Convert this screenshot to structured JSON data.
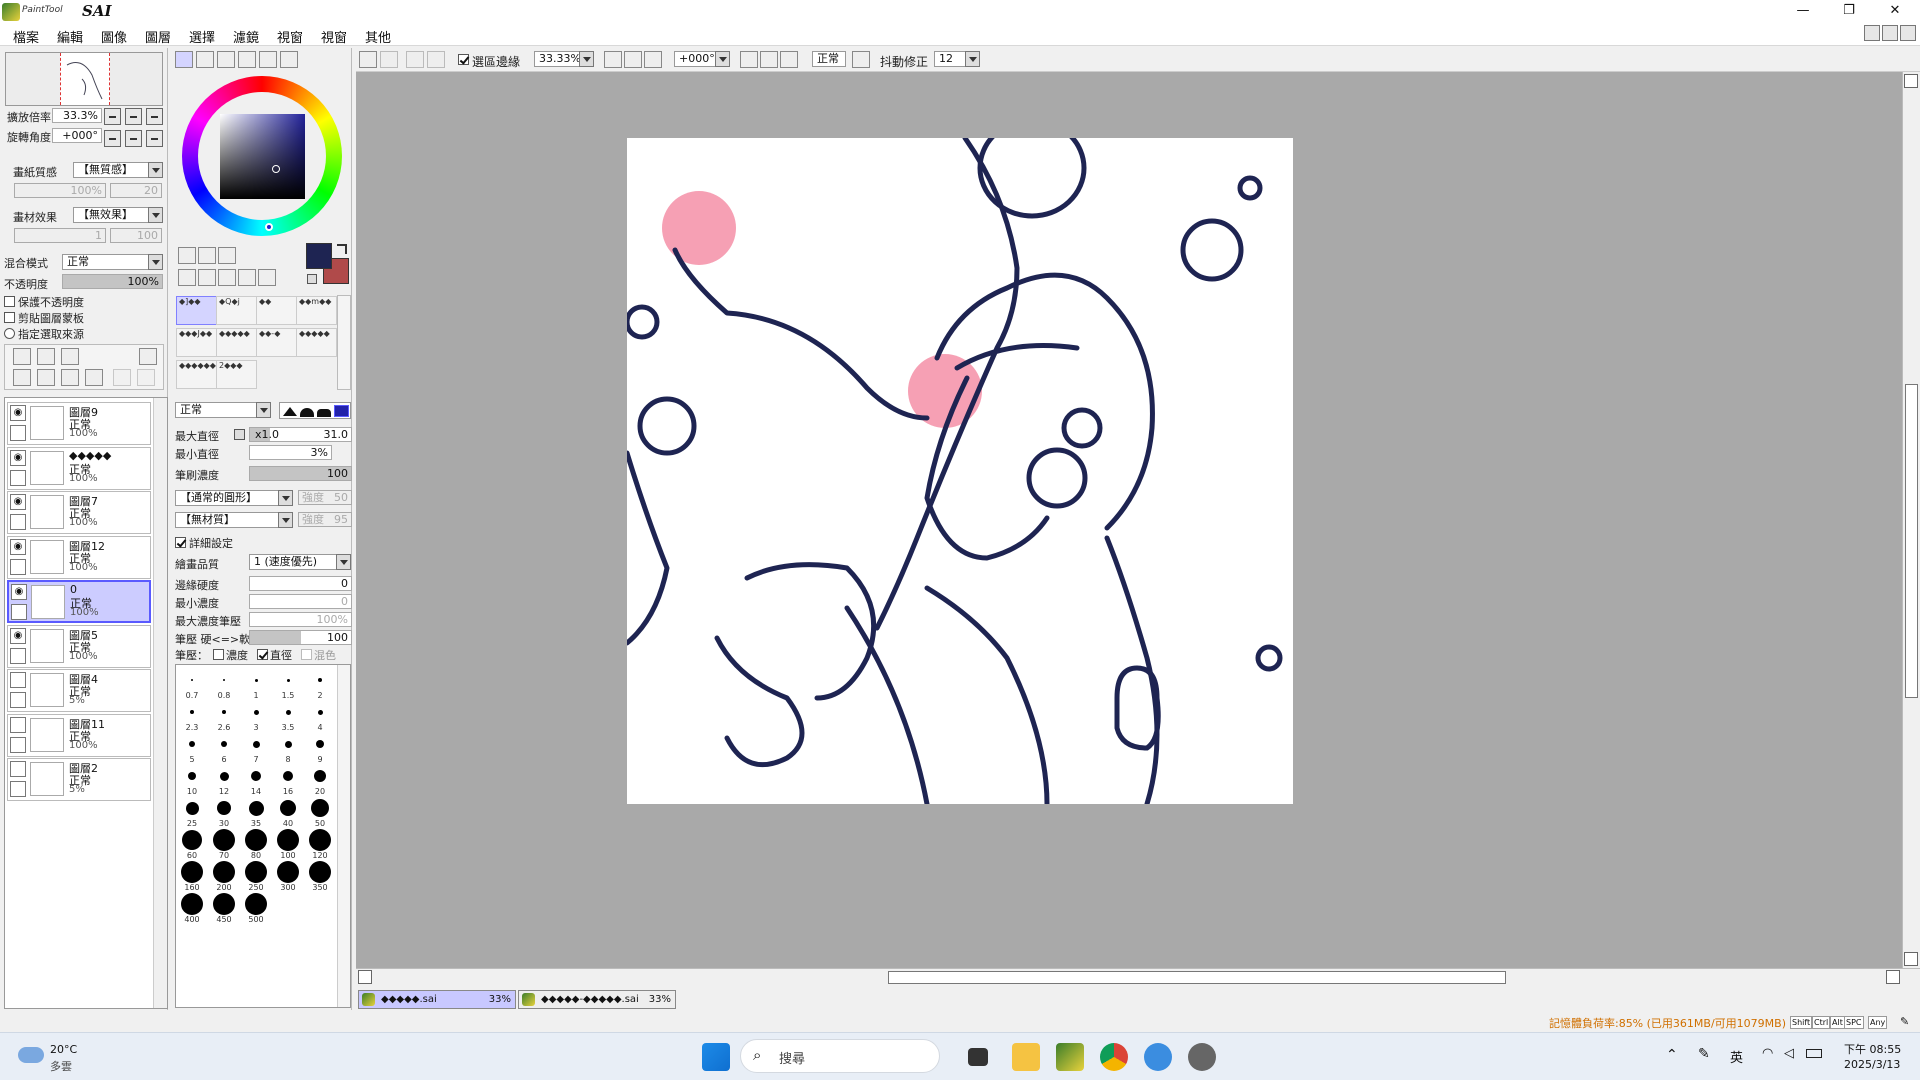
{
  "titlebar": {
    "brand_small": "PaintTool",
    "brand": "SAI",
    "minimize": "—",
    "restore": "❐",
    "close": "✕"
  },
  "menu": [
    "檔案",
    "編輯",
    "圖像",
    "圖層",
    "選擇",
    "濾鏡",
    "視窗",
    "視窗",
    "其他"
  ],
  "navigator": {
    "zoom_label": "擴放倍率",
    "zoom_value": "33.3%",
    "rotate_label": "旋轉角度",
    "rotate_value": "+000°"
  },
  "paper": {
    "texture_label": "畫紙質感",
    "texture_value": "【無質感】",
    "rate_label": "倍率",
    "rate_value": "100%",
    "strength_label": "強度",
    "strength_value": "20",
    "effect_label": "畫材效果",
    "effect_value": "【無效果】",
    "degree_label": "程度",
    "degree_value": "1",
    "strength2_label": "強度",
    "strength2_value": "100"
  },
  "layer_props": {
    "blend_label": "混合模式",
    "blend_value": "正常",
    "opacity_label": "不透明度",
    "opacity_value": "100%",
    "opacity_fraction": 1.0,
    "preserve_opacity": "保護不透明度",
    "clip_group": "剪貼圖層蒙板",
    "selection_source": "指定選取來源"
  },
  "layers": [
    {
      "name": "圖層9",
      "mode": "正常",
      "opacity": "100%",
      "visible": true,
      "selected": false
    },
    {
      "name": "◆◆◆◆◆",
      "mode": "正常",
      "opacity": "100%",
      "visible": true,
      "selected": false
    },
    {
      "name": "圖層7",
      "mode": "正常",
      "opacity": "100%",
      "visible": true,
      "selected": false
    },
    {
      "name": "圖層12",
      "mode": "正常",
      "opacity": "100%",
      "visible": true,
      "selected": false
    },
    {
      "name": "0",
      "mode": "正常",
      "opacity": "100%",
      "visible": true,
      "selected": true
    },
    {
      "name": "圖層5",
      "mode": "正常",
      "opacity": "100%",
      "visible": true,
      "selected": false
    },
    {
      "name": "圖層4",
      "mode": "正常",
      "opacity": "5%",
      "visible": false,
      "selected": false
    },
    {
      "name": "圖層11",
      "mode": "正常",
      "opacity": "100%",
      "visible": false,
      "selected": false
    },
    {
      "name": "圖層2",
      "mode": "正常",
      "opacity": "5%",
      "visible": false,
      "selected": false
    }
  ],
  "colors": {
    "primary": "#1e2452",
    "secondary": "#b04a4a",
    "line": "#1e2452",
    "blush": "#f6a0b4",
    "accent": "#5a5aff"
  },
  "tools": [
    "◆]◆◆",
    "◆Q◆j",
    "◆◆",
    "◆◆m◆◆",
    "◆◆◆J◆◆",
    "◆◆◆◆◆",
    "◆◆-◆",
    "◆◆◆◆◆",
    "◆◆◆◆◆◆",
    "2◆◆◆"
  ],
  "brush": {
    "mode": "正常",
    "max_size_label": "最大直徑",
    "max_size_mult": "x1.0",
    "max_size_value": "31.0",
    "min_size_label": "最小直徑",
    "min_size_value": "3%",
    "density_label": "筆刷濃度",
    "density_value": "100",
    "shape_value": "【通常的圓形】",
    "shape_strength_label": "強度",
    "shape_strength_value": "50",
    "texture_value": "【無材質】",
    "texture_strength_label": "強度",
    "texture_strength_value": "95",
    "detail_label": "詳細設定",
    "quality_label": "繪畫品質",
    "quality_value": "1 (速度優先)",
    "edge_label": "邊緣硬度",
    "edge_value": "0",
    "min_density_label": "最小濃度",
    "min_density_value": "0",
    "max_press_label": "最大濃度筆壓",
    "max_press_value": "100%",
    "hardness_label": "筆壓 硬<=>軟",
    "hardness_value": "100",
    "pressure_label": "筆壓：",
    "pressure_density": "濃度",
    "pressure_size": "直徑",
    "pressure_blend": "混色"
  },
  "brush_sizes": [
    "0.7",
    "0.8",
    "1",
    "1.5",
    "2",
    "2.3",
    "2.6",
    "3",
    "3.5",
    "4",
    "5",
    "6",
    "7",
    "8",
    "9",
    "10",
    "12",
    "14",
    "16",
    "20",
    "25",
    "30",
    "35",
    "40",
    "50",
    "60",
    "70",
    "80",
    "100",
    "120",
    "160",
    "200",
    "250",
    "300",
    "350",
    "400",
    "450",
    "500"
  ],
  "canvas_toolbar": {
    "selection_edge": "選區邊緣",
    "zoom": "33.33%",
    "angle": "+000°",
    "mode": "正常",
    "stabilizer_label": "抖動修正",
    "stabilizer_value": "12"
  },
  "file_tabs": [
    {
      "name": "◆◆◆◆◆.sai",
      "zoom": "33%"
    },
    {
      "name": "◆◆◆◆◆-◆◆◆◆◆.sai",
      "zoom": "33%"
    }
  ],
  "status": {
    "memory": "記憶體負荷率:85% (已用361MB/可用1079MB)",
    "keys": [
      "Shift",
      "Ctrl",
      "Alt",
      "SPC",
      "Any"
    ]
  },
  "taskbar": {
    "temp": "20°C",
    "weather": "多雲",
    "search": "搜尋",
    "ime": "英",
    "time": "下午 08:55",
    "date": "2025/3/13"
  }
}
